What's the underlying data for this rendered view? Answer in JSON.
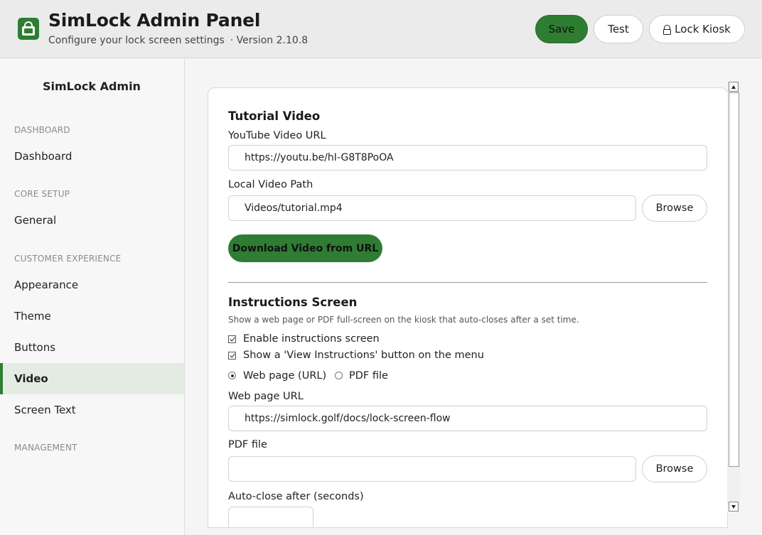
{
  "header": {
    "title": "SimLock Admin Panel",
    "subtitle": "Configure your lock screen settings",
    "version": "· Version 2.10.8",
    "save_label": "Save",
    "test_label": "Test",
    "lock_label": "Lock Kiosk"
  },
  "sidebar": {
    "title": "SimLock Admin",
    "sections": {
      "dashboard": "DASHBOARD",
      "core_setup": "CORE SETUP",
      "customer_experience": "CUSTOMER EXPERIENCE",
      "management": "MANAGEMENT"
    },
    "items": [
      {
        "label": "Dashboard",
        "active": false
      },
      {
        "label": "General",
        "active": false
      },
      {
        "label": "Appearance",
        "active": false
      },
      {
        "label": "Theme",
        "active": false
      },
      {
        "label": "Buttons",
        "active": false
      },
      {
        "label": "Video",
        "active": true
      },
      {
        "label": "Screen Text",
        "active": false
      }
    ]
  },
  "tutorial": {
    "heading": "Tutorial Video",
    "youtube_label": "YouTube Video URL",
    "youtube_value": "https://youtu.be/hI-G8T8PoOA",
    "local_label": "Local Video Path",
    "local_value": "Videos/tutorial.mp4",
    "browse_label": "Browse",
    "download_label": "Download Video from URL"
  },
  "instructions": {
    "heading": "Instructions Screen",
    "help": "Show a web page or PDF full-screen on the kiosk that auto-closes after a set time.",
    "enable_label": "Enable instructions screen",
    "enable_checked": true,
    "show_button_label": "Show a 'View Instructions' button on the menu",
    "show_button_checked": true,
    "source_options": [
      "Web page (URL)",
      "PDF file"
    ],
    "source_selected": "Web page (URL)",
    "url_label": "Web page URL",
    "url_value": "https://simlock.golf/docs/lock-screen-flow",
    "pdf_label": "PDF file",
    "pdf_value": "",
    "browse_label": "Browse",
    "autoclose_label": "Auto-close after (seconds)"
  },
  "colors": {
    "accent": "#2e7d32",
    "active_nav_bg": "#e3ebe3"
  }
}
